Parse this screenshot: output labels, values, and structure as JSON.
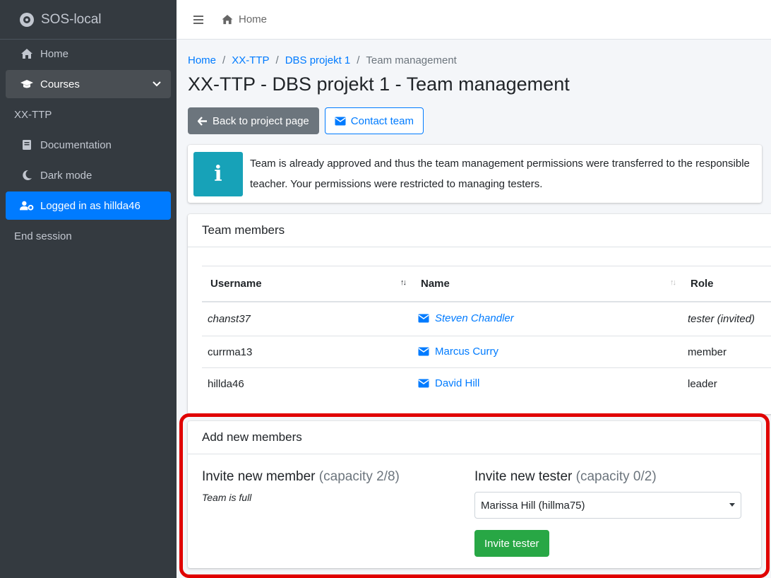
{
  "app": {
    "brand": "SOS-local"
  },
  "sidebar": {
    "items": [
      {
        "label": "Home",
        "icon": "home-icon"
      },
      {
        "label": "Courses",
        "icon": "graduation-cap-icon"
      },
      {
        "label": "XX-TTP"
      },
      {
        "label": "Documentation",
        "icon": "book-icon"
      },
      {
        "label": "Dark mode",
        "icon": "moon-icon"
      },
      {
        "label": "Logged in as hillda46",
        "icon": "user-cog-icon"
      },
      {
        "label": "End session"
      }
    ]
  },
  "topbar": {
    "home_label": "Home"
  },
  "breadcrumb": [
    "Home",
    "XX-TTP",
    "DBS projekt 1",
    "Team management"
  ],
  "page": {
    "title": "XX-TTP - DBS projekt 1 - Team management",
    "back_button": "Back to project page",
    "contact_button": "Contact team",
    "info_text": "Team is already approved and thus the team management permissions were transferred to the responsible teacher. Your permissions were restricted to managing testers."
  },
  "members_card": {
    "title": "Team members",
    "columns": [
      "Username",
      "Name",
      "Role"
    ],
    "rows": [
      {
        "username": "chanst37",
        "name": "Steven Chandler",
        "role": "tester (invited)"
      },
      {
        "username": "currma13",
        "name": "Marcus Curry",
        "role": "member"
      },
      {
        "username": "hillda46",
        "name": "David Hill",
        "role": "leader"
      }
    ]
  },
  "add_card": {
    "title": "Add new members",
    "member_heading": "Invite new member",
    "member_capacity": "(capacity 2/8)",
    "team_full": "Team is full",
    "tester_heading": "Invite new tester",
    "tester_capacity": "(capacity 0/2)",
    "tester_select_value": "Marissa Hill (hillma75)",
    "invite_button": "Invite tester"
  },
  "colors": {
    "primary": "#007bff",
    "sidebar": "#343a40",
    "info": "#17a2b8",
    "success": "#28a745",
    "highlight": "#e00000"
  }
}
